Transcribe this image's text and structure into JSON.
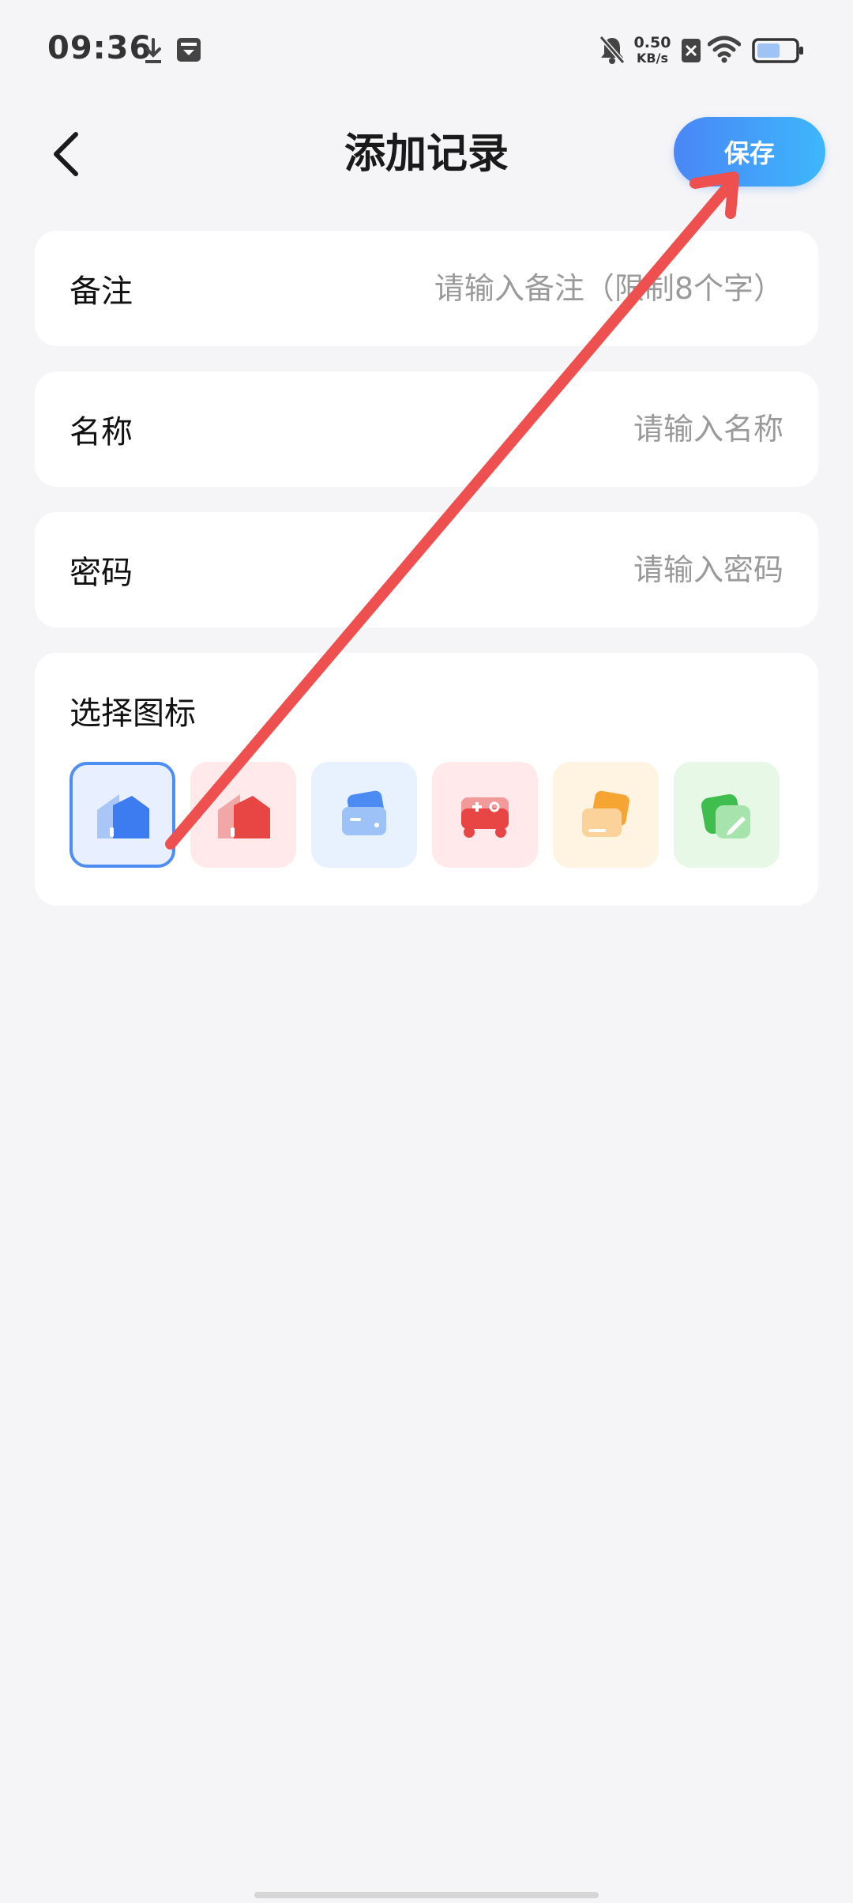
{
  "status_bar": {
    "time": "09:36",
    "net_speed_value": "0.50",
    "net_speed_unit": "KB/s",
    "icons": [
      "download-icon",
      "storage-icon",
      "mute-icon",
      "sim-off-icon",
      "wifi-icon",
      "battery-icon"
    ]
  },
  "header": {
    "title": "添加记录",
    "save_label": "保存",
    "back_icon": "chevron-left-icon",
    "save_color_start": "#4a86f7",
    "save_color_end": "#3db7fb"
  },
  "form": {
    "note": {
      "label": "备注",
      "placeholder": "请输入备注（限制8个字）",
      "value": ""
    },
    "name": {
      "label": "名称",
      "placeholder": "请输入名称",
      "value": ""
    },
    "password": {
      "label": "密码",
      "placeholder": "请输入密码",
      "value": ""
    }
  },
  "icon_picker": {
    "title": "选择图标",
    "selected_index": 0,
    "selected_color": "#4e8ef2",
    "options": [
      {
        "name": "home-blue-icon",
        "bg": "#e8f0ff"
      },
      {
        "name": "home-red-icon",
        "bg": "#ffe9ea"
      },
      {
        "name": "card-blue-icon",
        "bg": "#e8f2ff"
      },
      {
        "name": "game-controller-icon",
        "bg": "#ffe9ea"
      },
      {
        "name": "card-orange-icon",
        "bg": "#fff4e2"
      },
      {
        "name": "note-green-icon",
        "bg": "#e7f8e7"
      }
    ]
  },
  "annotation": {
    "type": "arrow",
    "color": "#ee4f4f",
    "target": "save-button"
  }
}
